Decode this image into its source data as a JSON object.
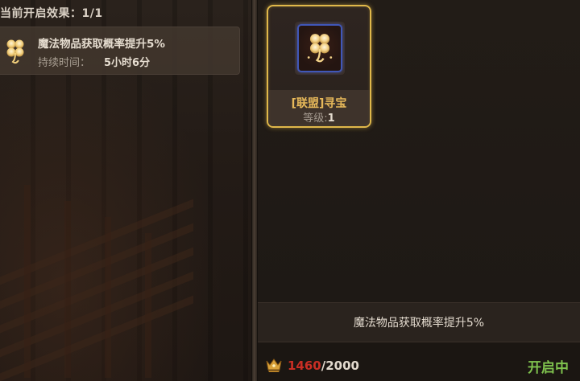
{
  "left": {
    "active_count_label": "当前开启效果：1/1",
    "effect": {
      "name": "魔法物品获取概率提升5%",
      "duration_label": "持续时间：",
      "duration_value": "5小时6分",
      "icon": "clover-icon"
    }
  },
  "right": {
    "skill": {
      "name": "[联盟]寻宝",
      "level_label": "等级:",
      "level_value": "1",
      "icon": "clover-icon",
      "selected": true
    },
    "description": "魔法物品获取概率提升5%",
    "resource": {
      "icon": "crown-icon",
      "current": "1460",
      "separator": "/",
      "max": "2000"
    },
    "status": "开启中"
  },
  "colors": {
    "selected_border": "#e0b84a",
    "status_active": "#7fc24e",
    "resource_insufficient": "#c92e24",
    "skill_name": "#e7b95a"
  }
}
